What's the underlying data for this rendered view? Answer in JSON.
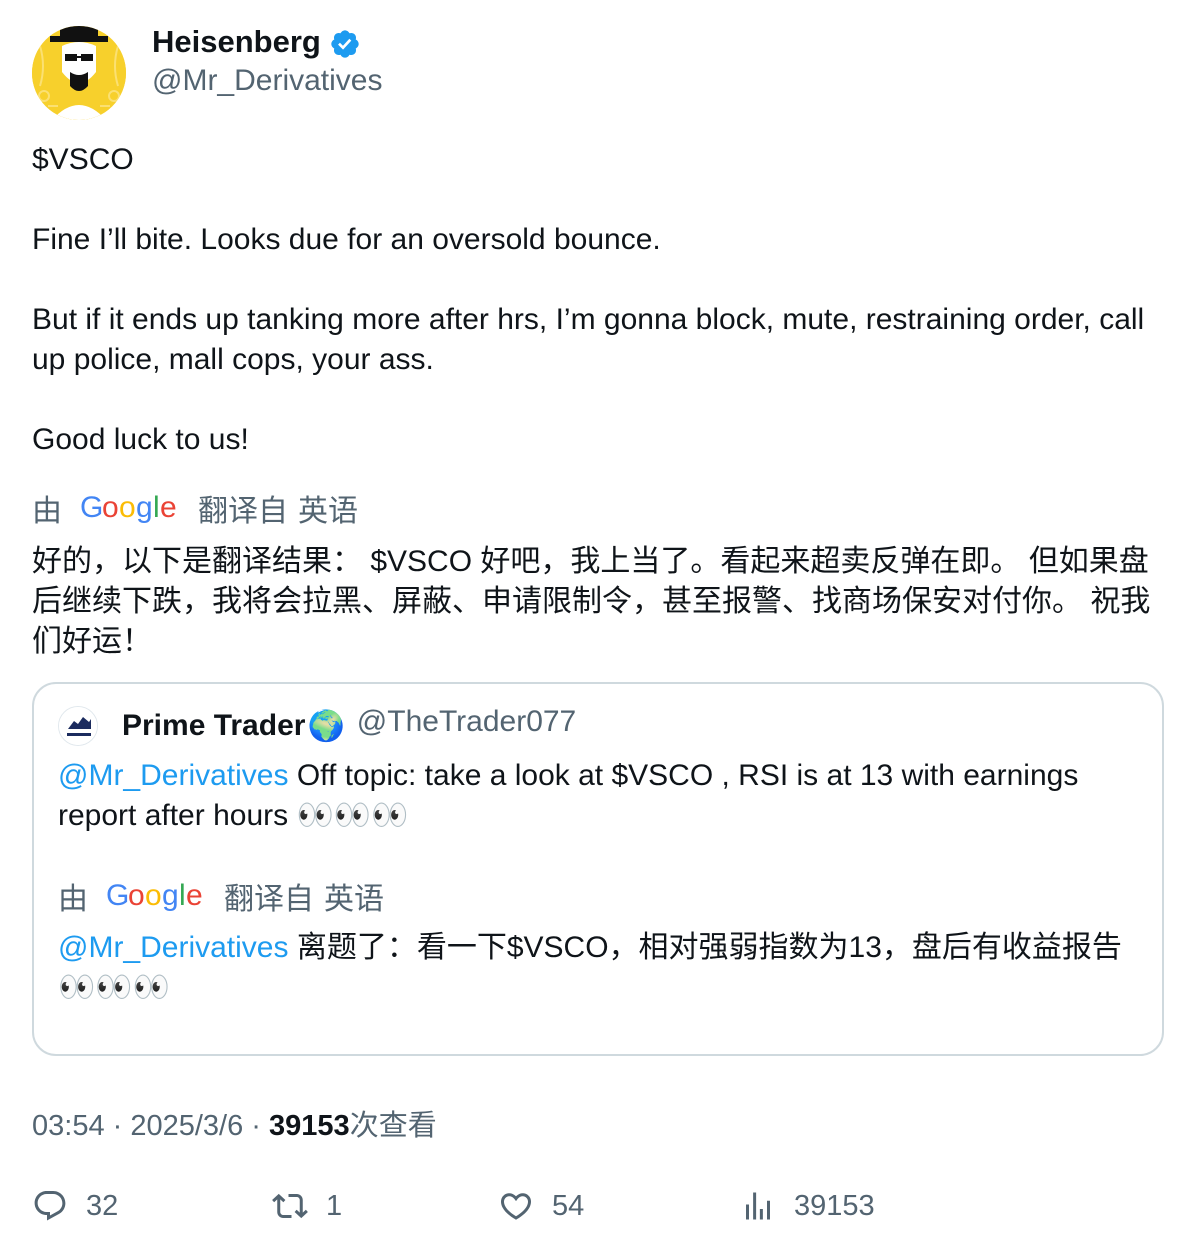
{
  "author": {
    "name": "Heisenberg",
    "handle": "@Mr_Derivatives",
    "avatar_icon": "heisenberg-avatar-icon",
    "verified_icon": "verified-badge-icon"
  },
  "tweet": {
    "lines": [
      "$VSCO",
      "Fine I’ll bite. Looks due for an oversold bounce.",
      "But if it ends up tanking more after hrs, I’m gonna block, mute, restraining order, call up police, mall cops, your ass.",
      "Good luck to us!"
    ]
  },
  "translation": {
    "by": "由",
    "google": "Google",
    "from_label": "翻译自",
    "language": "英语",
    "text": "好的，以下是翻译结果： $VSCO 好吧，我上当了。看起来超卖反弹在即。 但如果盘后继续下跌，我将会拉黑、屏蔽、申请限制令，甚至报警、找商场保安对付你。 祝我们好运！"
  },
  "quoted": {
    "name": "Prime Trader",
    "globe": "🌍",
    "handle": "@TheTrader077",
    "mention": "@Mr_Derivatives",
    "text": " Off topic: take a look at $VSCO , RSI is at 13 with earnings report after hours 👀👀👀",
    "translation": {
      "by": "由",
      "google": "Google",
      "from_label": "翻译自",
      "language": "英语",
      "mention": "@Mr_Derivatives",
      "text": " 离题了：看一下$VSCO，相对强弱指数为13，盘后有收益报告👀👀👀"
    }
  },
  "meta": {
    "time": "03:54",
    "sep1": " · ",
    "date": "2025/3/6",
    "sep2": " · ",
    "views": "39153",
    "views_label": "次查看"
  },
  "actions": {
    "replies": "32",
    "retweets": "1",
    "likes": "54",
    "views": "39153"
  },
  "colors": {
    "link": "#1d9bf0",
    "secondary": "#536471",
    "border": "#cfd9de",
    "text": "#0f1419"
  }
}
